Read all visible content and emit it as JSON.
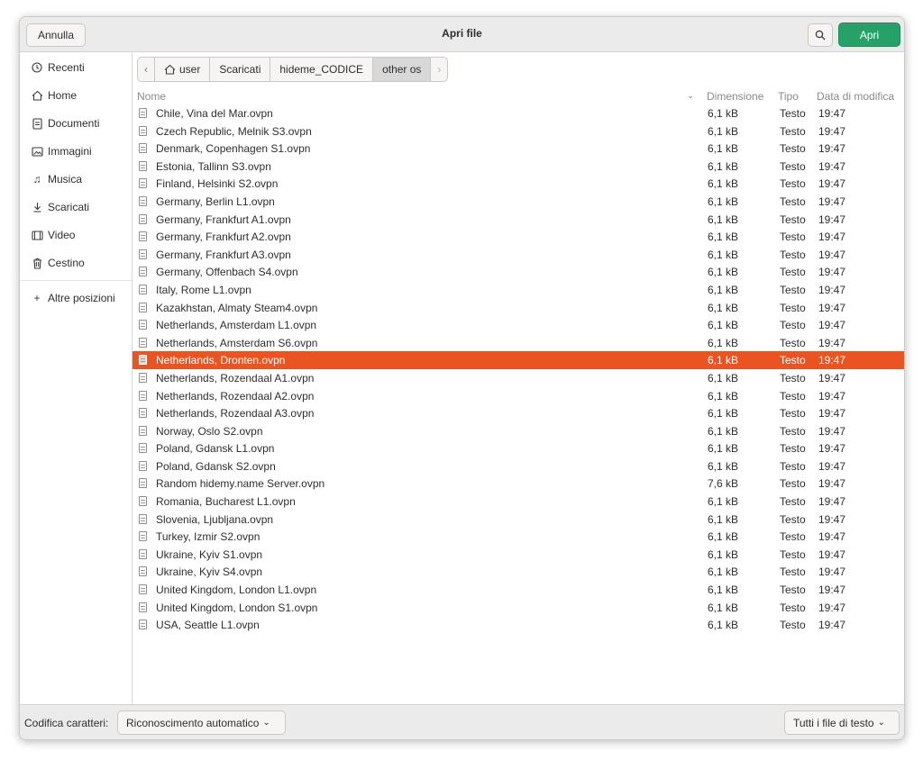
{
  "header": {
    "cancel_label": "Annulla",
    "title": "Apri file",
    "open_label": "Apri"
  },
  "sidebar": {
    "items": [
      {
        "label": "Recenti",
        "icon": "clock-icon"
      },
      {
        "label": "Home",
        "icon": "home-icon"
      },
      {
        "label": "Documenti",
        "icon": "document-icon"
      },
      {
        "label": "Immagini",
        "icon": "image-icon"
      },
      {
        "label": "Musica",
        "icon": "music-icon"
      },
      {
        "label": "Scaricati",
        "icon": "download-icon"
      },
      {
        "label": "Video",
        "icon": "video-icon"
      },
      {
        "label": "Cestino",
        "icon": "trash-icon"
      }
    ],
    "other_locations": "Altre posizioni"
  },
  "pathbar": {
    "crumbs": [
      "user",
      "Scaricati",
      "hideme_CODICE",
      "other os"
    ],
    "active_index": 3
  },
  "columns": {
    "name": "Nome",
    "size": "Dimensione",
    "type": "Tipo",
    "date": "Data di modifica"
  },
  "files": [
    {
      "name": "Chile, Vina del Mar.ovpn",
      "size": "6,1 kB",
      "type": "Testo",
      "date": "19:47"
    },
    {
      "name": "Czech Republic, Melnik S3.ovpn",
      "size": "6,1 kB",
      "type": "Testo",
      "date": "19:47"
    },
    {
      "name": "Denmark, Copenhagen S1.ovpn",
      "size": "6,1 kB",
      "type": "Testo",
      "date": "19:47"
    },
    {
      "name": "Estonia, Tallinn S3.ovpn",
      "size": "6,1 kB",
      "type": "Testo",
      "date": "19:47"
    },
    {
      "name": "Finland, Helsinki S2.ovpn",
      "size": "6,1 kB",
      "type": "Testo",
      "date": "19:47"
    },
    {
      "name": "Germany, Berlin L1.ovpn",
      "size": "6,1 kB",
      "type": "Testo",
      "date": "19:47"
    },
    {
      "name": "Germany, Frankfurt A1.ovpn",
      "size": "6,1 kB",
      "type": "Testo",
      "date": "19:47"
    },
    {
      "name": "Germany, Frankfurt A2.ovpn",
      "size": "6,1 kB",
      "type": "Testo",
      "date": "19:47"
    },
    {
      "name": "Germany, Frankfurt A3.ovpn",
      "size": "6,1 kB",
      "type": "Testo",
      "date": "19:47"
    },
    {
      "name": "Germany, Offenbach S4.ovpn",
      "size": "6,1 kB",
      "type": "Testo",
      "date": "19:47"
    },
    {
      "name": "Italy, Rome L1.ovpn",
      "size": "6,1 kB",
      "type": "Testo",
      "date": "19:47"
    },
    {
      "name": "Kazakhstan, Almaty Steam4.ovpn",
      "size": "6,1 kB",
      "type": "Testo",
      "date": "19:47"
    },
    {
      "name": "Netherlands, Amsterdam L1.ovpn",
      "size": "6,1 kB",
      "type": "Testo",
      "date": "19:47"
    },
    {
      "name": "Netherlands, Amsterdam S6.ovpn",
      "size": "6,1 kB",
      "type": "Testo",
      "date": "19:47"
    },
    {
      "name": "Netherlands, Dronten.ovpn",
      "size": "6,1 kB",
      "type": "Testo",
      "date": "19:47",
      "selected": true
    },
    {
      "name": "Netherlands, Rozendaal A1.ovpn",
      "size": "6,1 kB",
      "type": "Testo",
      "date": "19:47"
    },
    {
      "name": "Netherlands, Rozendaal A2.ovpn",
      "size": "6,1 kB",
      "type": "Testo",
      "date": "19:47"
    },
    {
      "name": "Netherlands, Rozendaal A3.ovpn",
      "size": "6,1 kB",
      "type": "Testo",
      "date": "19:47"
    },
    {
      "name": "Norway, Oslo S2.ovpn",
      "size": "6,1 kB",
      "type": "Testo",
      "date": "19:47"
    },
    {
      "name": "Poland, Gdansk L1.ovpn",
      "size": "6,1 kB",
      "type": "Testo",
      "date": "19:47"
    },
    {
      "name": "Poland, Gdansk S2.ovpn",
      "size": "6,1 kB",
      "type": "Testo",
      "date": "19:47"
    },
    {
      "name": "Random hidemy.name Server.ovpn",
      "size": "7,6 kB",
      "type": "Testo",
      "date": "19:47"
    },
    {
      "name": "Romania, Bucharest L1.ovpn",
      "size": "6,1 kB",
      "type": "Testo",
      "date": "19:47"
    },
    {
      "name": "Slovenia, Ljubljana.ovpn",
      "size": "6,1 kB",
      "type": "Testo",
      "date": "19:47"
    },
    {
      "name": "Turkey, Izmir S2.ovpn",
      "size": "6,1 kB",
      "type": "Testo",
      "date": "19:47"
    },
    {
      "name": "Ukraine, Kyiv S1.ovpn",
      "size": "6,1 kB",
      "type": "Testo",
      "date": "19:47"
    },
    {
      "name": "Ukraine, Kyiv S4.ovpn",
      "size": "6,1 kB",
      "type": "Testo",
      "date": "19:47"
    },
    {
      "name": "United Kingdom, London L1.ovpn",
      "size": "6,1 kB",
      "type": "Testo",
      "date": "19:47"
    },
    {
      "name": "United Kingdom, London S1.ovpn",
      "size": "6,1 kB",
      "type": "Testo",
      "date": "19:47"
    },
    {
      "name": "USA, Seattle L1.ovpn",
      "size": "6,1 kB",
      "type": "Testo",
      "date": "19:47"
    }
  ],
  "footer": {
    "encoding_label": "Codifica caratteri:",
    "encoding_value": "Riconoscimento automatico",
    "filter_value": "Tutti i file di testo"
  },
  "colors": {
    "accent_selection": "#e95420",
    "open_button": "#26a269"
  }
}
